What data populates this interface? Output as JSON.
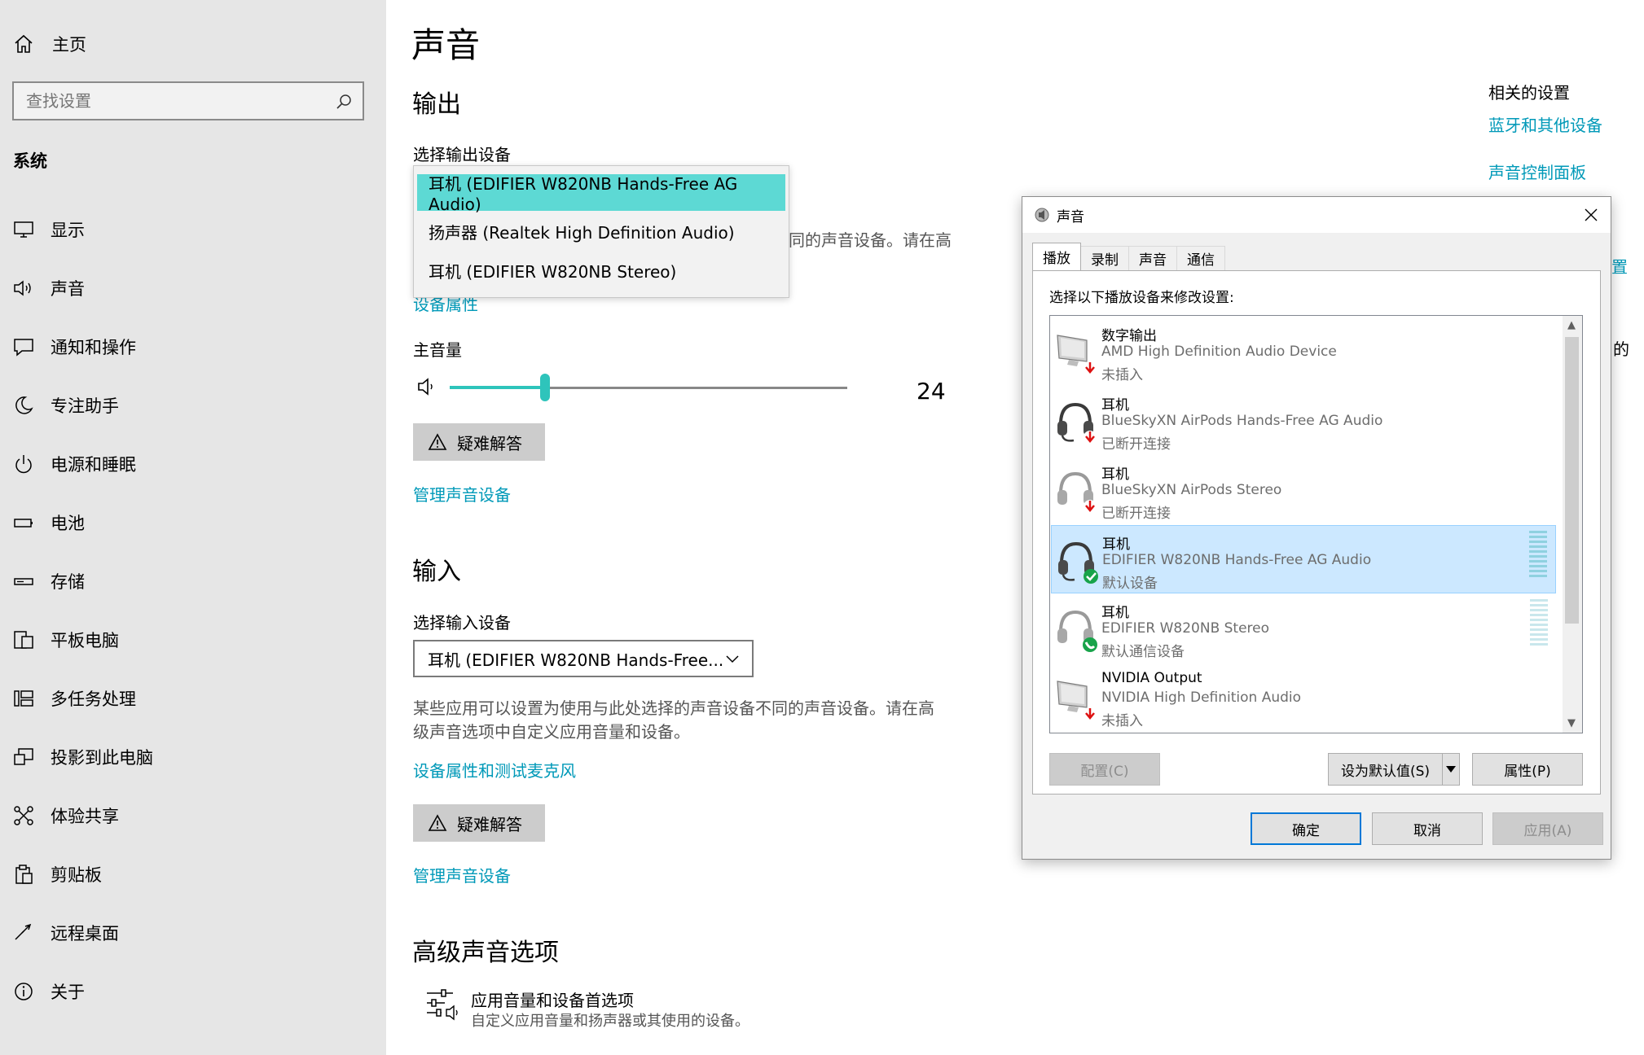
{
  "sidebar": {
    "home_label": "主页",
    "search_placeholder": "查找设置",
    "section_title": "系统",
    "items": [
      {
        "label": "显示",
        "icon": "monitor-icon"
      },
      {
        "label": "声音",
        "icon": "speaker-icon"
      },
      {
        "label": "通知和操作",
        "icon": "notification-icon"
      },
      {
        "label": "专注助手",
        "icon": "moon-icon"
      },
      {
        "label": "电源和睡眠",
        "icon": "power-icon"
      },
      {
        "label": "电池",
        "icon": "battery-icon"
      },
      {
        "label": "存储",
        "icon": "storage-icon"
      },
      {
        "label": "平板电脑",
        "icon": "tablet-icon"
      },
      {
        "label": "多任务处理",
        "icon": "multitask-icon"
      },
      {
        "label": "投影到此电脑",
        "icon": "project-icon"
      },
      {
        "label": "体验共享",
        "icon": "share-icon"
      },
      {
        "label": "剪贴板",
        "icon": "clipboard-icon"
      },
      {
        "label": "远程桌面",
        "icon": "remote-icon"
      },
      {
        "label": "关于",
        "icon": "info-icon"
      }
    ]
  },
  "main": {
    "title": "声音",
    "output": {
      "heading": "输出",
      "select_label": "选择输出设备",
      "options": [
        "耳机 (EDIFIER W820NB Hands-Free AG Audio)",
        "扬声器 (Realtek High Definition Audio)",
        "耳机 (EDIFIER W820NB Stereo)"
      ],
      "selected_index": 0,
      "partial_desc": "同的声音设备。请在高",
      "partial_link": "设备属性",
      "volume_label": "主音量",
      "volume_value": "24",
      "volume_level": 0.24,
      "troubleshoot": "疑难解答",
      "manage_link": "管理声音设备"
    },
    "input": {
      "heading": "输入",
      "select_label": "选择输入设备",
      "selected": "耳机 (EDIFIER W820NB Hands-Free...",
      "desc_line1": "某些应用可以设置为使用与此处选择的声音设备不同的声音设备。请在高",
      "desc_line2": "级声音选项中自定义应用音量和设备。",
      "props_link": "设备属性和测试麦克风",
      "troubleshoot": "疑难解答",
      "manage_link": "管理声音设备"
    },
    "advanced": {
      "heading": "高级声音选项",
      "item_title": "应用音量和设备首选项",
      "item_desc": "自定义应用音量和扬声器或其使用的设备。"
    }
  },
  "related": {
    "heading": "相关的设置",
    "links": [
      "蓝牙和其他设备",
      "声音控制面板"
    ],
    "clipped1": "置",
    "clipped2": "的"
  },
  "dialog": {
    "title": "声音",
    "tabs": [
      "播放",
      "录制",
      "声音",
      "通信"
    ],
    "active_tab": 0,
    "instruction": "选择以下播放设备来修改设置:",
    "devices": [
      {
        "name": "数字输出",
        "desc": "AMD High Definition Audio Device",
        "status": "未插入",
        "icon": "monitor-device-icon",
        "badge": "down-arrow",
        "selected": false
      },
      {
        "name": "耳机",
        "desc": "BlueSkyXN AirPods Hands-Free AG Audio",
        "status": "已断开连接",
        "icon": "headset-device-icon",
        "badge": "down-arrow",
        "selected": false
      },
      {
        "name": "耳机",
        "desc": "BlueSkyXN AirPods Stereo",
        "status": "已断开连接",
        "icon": "headphones-device-icon",
        "badge": "down-arrow",
        "selected": false
      },
      {
        "name": "耳机",
        "desc": "EDIFIER W820NB Hands-Free AG Audio",
        "status": "默认设备",
        "icon": "headset-device-icon",
        "badge": "check",
        "selected": true
      },
      {
        "name": "耳机",
        "desc": "EDIFIER W820NB Stereo",
        "status": "默认通信设备",
        "icon": "headphones-device-icon",
        "badge": "phone",
        "selected": false
      },
      {
        "name": "NVIDIA Output",
        "desc": "NVIDIA High Definition Audio",
        "status": "未插入",
        "icon": "monitor-device-icon",
        "badge": "down-arrow",
        "selected": false
      }
    ],
    "btn_configure": "配置(C)",
    "btn_set_default": "设为默认值(S)",
    "btn_properties": "属性(P)",
    "btn_ok": "确定",
    "btn_cancel": "取消",
    "btn_apply": "应用(A)"
  },
  "colors": {
    "accent": "#0099b8",
    "teal": "#2ec4bb",
    "selected_option": "#5dd9d4",
    "sidebar_bg": "#e6e6e6",
    "list_selected": "#cce8ff"
  }
}
